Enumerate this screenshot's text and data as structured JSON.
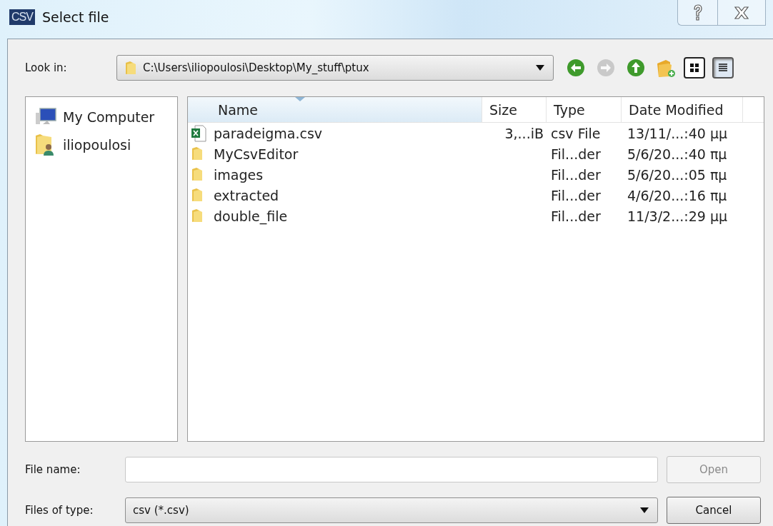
{
  "window": {
    "title": "Select file",
    "app_icon": "CSV"
  },
  "look_in": {
    "label": "Look in:",
    "path": "C:\\Users\\iliopoulosi\\Desktop\\My_stuff\\ptux"
  },
  "nav_buttons": [
    {
      "kind": "back",
      "disabled": false
    },
    {
      "kind": "forward",
      "disabled": true
    },
    {
      "kind": "up",
      "disabled": false
    },
    {
      "kind": "new_folder",
      "disabled": false
    }
  ],
  "view_buttons": [
    {
      "kind": "list",
      "selected": false
    },
    {
      "kind": "detail",
      "selected": true
    }
  ],
  "sidebar": {
    "items": [
      {
        "kind": "computer",
        "label": "My Computer"
      },
      {
        "kind": "user",
        "label": "iliopoulosi"
      }
    ]
  },
  "table": {
    "columns": [
      {
        "label": "Name",
        "sorted": true
      },
      {
        "label": "Size",
        "sorted": false
      },
      {
        "label": "Type",
        "sorted": false
      },
      {
        "label": "Date Modified",
        "sorted": false
      }
    ],
    "rows": [
      {
        "kind": "csv",
        "name": "paradeigma.csv",
        "size": "3,...iB",
        "type": "csv File",
        "date": "13/11/...:40 μμ"
      },
      {
        "kind": "folder",
        "name": "MyCsvEditor",
        "type": "Fil...der",
        "date": "5/6/20...:40 πμ"
      },
      {
        "kind": "folder",
        "name": "images",
        "type": "Fil...der",
        "date": "5/6/20...:05 πμ"
      },
      {
        "kind": "folder",
        "name": "extracted",
        "type": "Fil...der",
        "date": "4/6/20...:16 πμ"
      },
      {
        "kind": "folder",
        "name": "double_file",
        "type": "Fil...der",
        "date": "11/3/2...:29 μμ"
      }
    ]
  },
  "file_name": {
    "label": "File name:"
  },
  "open_button": {
    "label": "Open",
    "disabled": true
  },
  "file_type": {
    "label": "Files of type:",
    "value": "csv (*.csv)"
  },
  "cancel_button": {
    "label": "Cancel",
    "disabled": false
  }
}
